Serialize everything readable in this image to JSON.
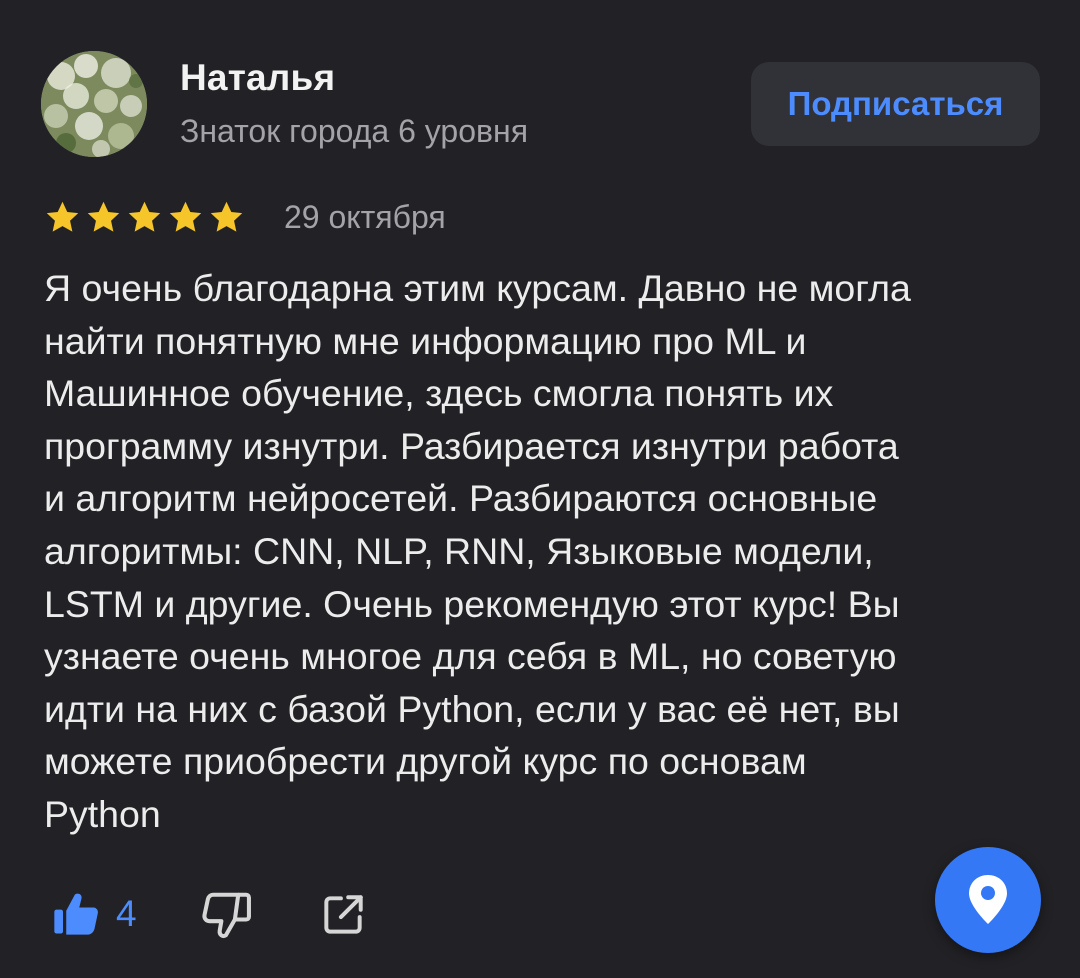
{
  "review": {
    "author": {
      "name": "Наталья",
      "level": "Знаток города 6 уровня",
      "avatar_icon": "avatar-image"
    },
    "subscribe_label": "Подписаться",
    "rating": 5,
    "rating_max": 5,
    "date": "29 октября",
    "text": "Я очень благодарна этим курсам. Давно не могла\nнайти понятную мне информацию про ML и\nМашинное обучение, здесь смогла понять их\nпрограмму изнутри. Разбирается изнутри работа\nи алгоритм нейросетей. Разбираются основные\nалгоритмы: CNN, NLP, RNN, Языковые модели,\nLSTM и другие. Очень рекомендую этот курс! Вы\nузнаете очень многое для себя в ML, но советую\nидти на них с базой Python, если у вас её нет, вы\nможете приобрести другой курс по основам\nPython"
  },
  "actions": {
    "like_count": "4",
    "like_icon": "thumbs-up-icon",
    "dislike_icon": "thumbs-down-icon",
    "share_icon": "share-icon",
    "fab_icon": "map-pin-icon"
  },
  "colors": {
    "background": "#222226",
    "accent": "#4c8cff",
    "fab": "#3478f6",
    "star": "#f6c529",
    "muted": "#a3a3a8"
  }
}
